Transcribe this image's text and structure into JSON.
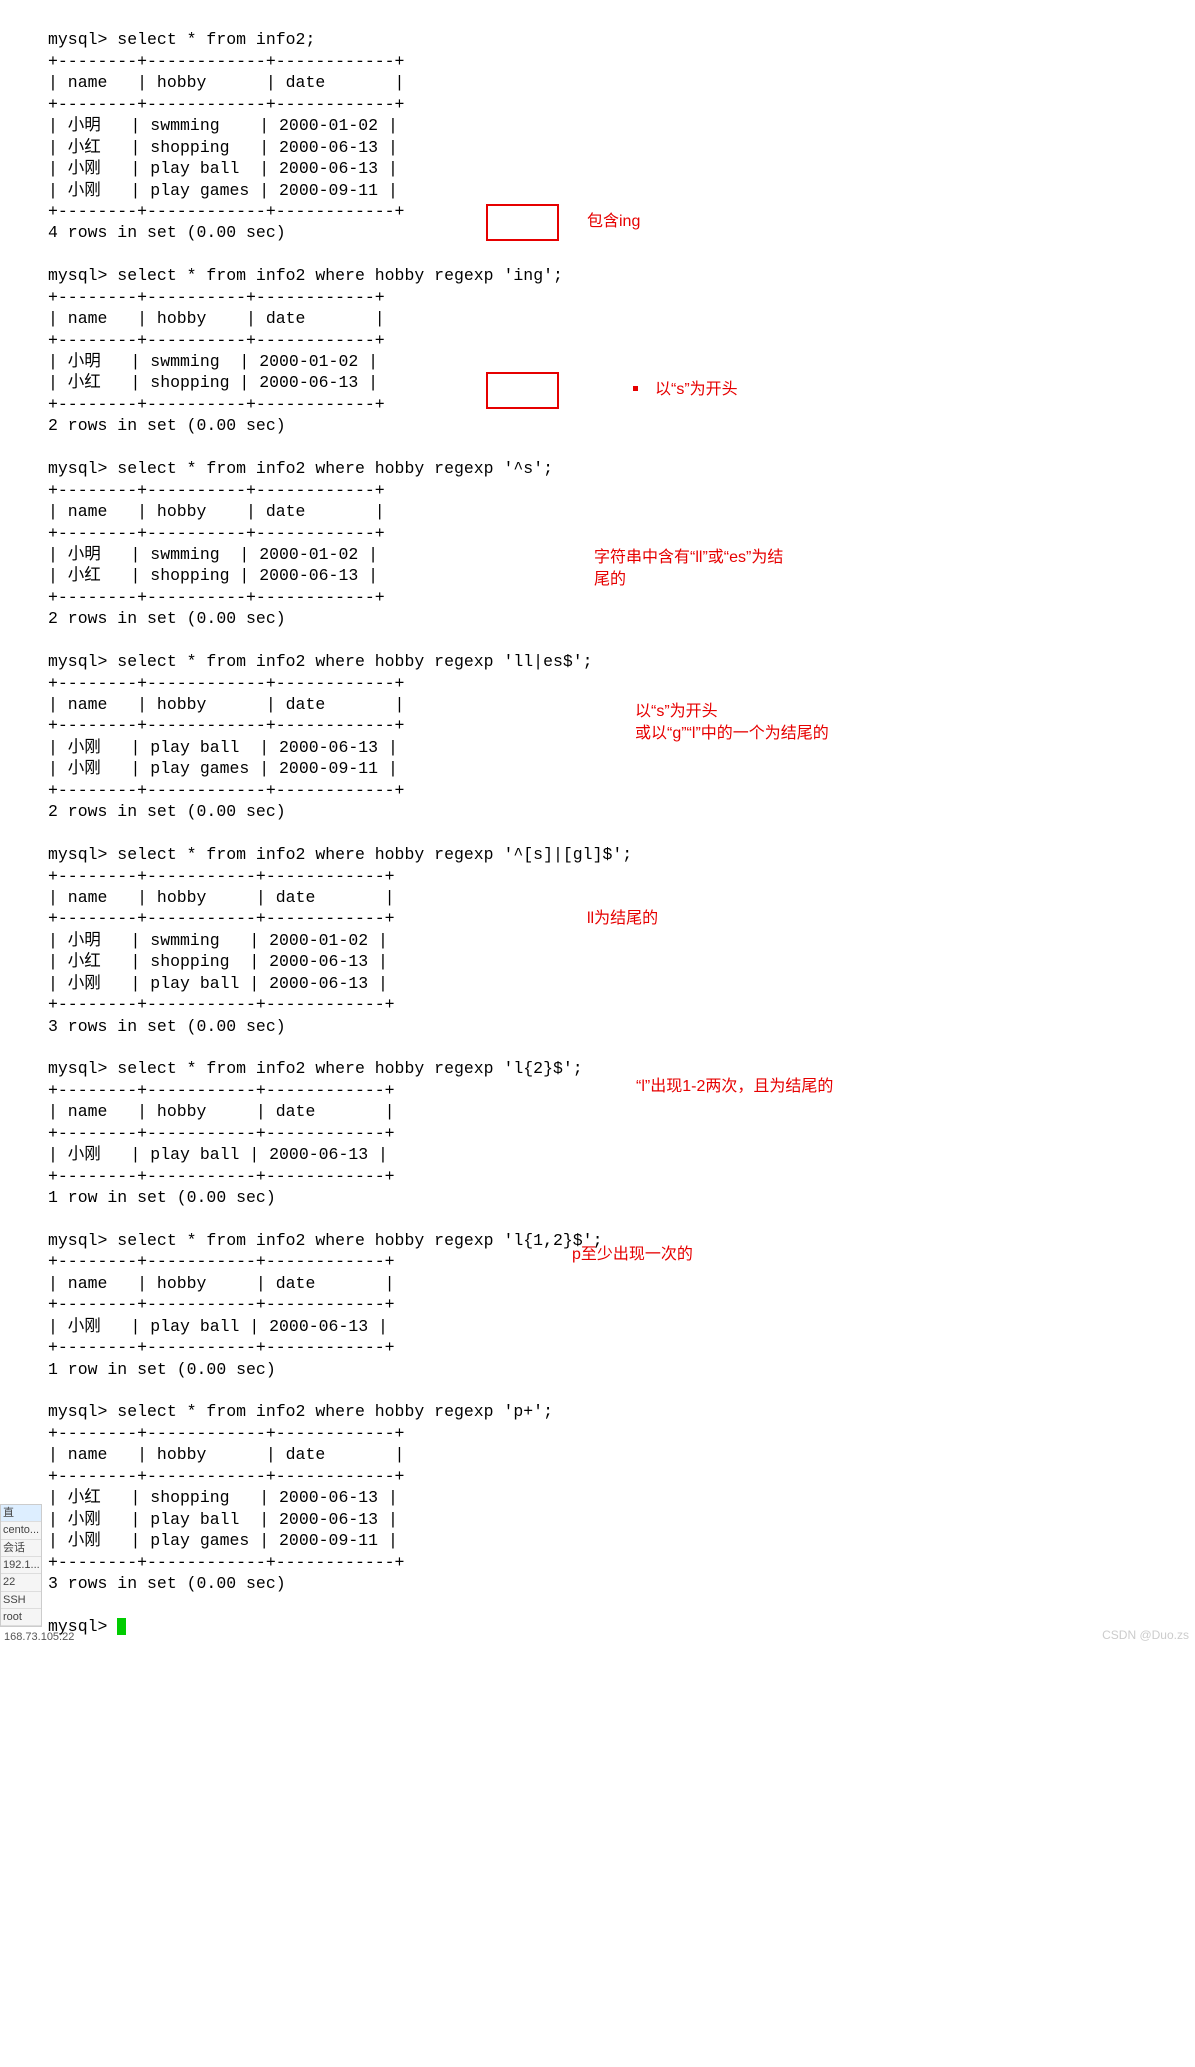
{
  "terminal": {
    "q1_prompt": "mysql> select * from info2;",
    "q1_table": "+--------+------------+------------+\n| name   | hobby      | date       |\n+--------+------------+------------+\n| 小明   | swmming    | 2000-01-02 |\n| 小红   | shopping   | 2000-06-13 |\n| 小刚   | play ball  | 2000-06-13 |\n| 小刚   | play games | 2000-09-11 |\n+--------+------------+------------+",
    "q1_result": "4 rows in set (0.00 sec)",
    "q2_prompt_a": "mysql> select * from info2 where hobby regexp ",
    "q2_prompt_b": "'ing';",
    "q2_table": "+--------+----------+------------+\n| name   | hobby    | date       |\n+--------+----------+------------+\n| 小明   | swmming  | 2000-01-02 |\n| 小红   | shopping | 2000-06-13 |\n+--------+----------+------------+",
    "q2_result": "2 rows in set (0.00 sec)",
    "q3_prompt_a": "mysql> select * from info2 where hobby regexp ",
    "q3_prompt_b": "'^s';",
    "q3_table": "+--------+----------+------------+\n| name   | hobby    | date       |\n+--------+----------+------------+\n| 小明   | swmming  | 2000-01-02 |\n| 小红   | shopping | 2000-06-13 |\n+--------+----------+------------+",
    "q3_result": "2 rows in set (0.00 sec)",
    "q4_prompt": "mysql> select * from info2 where hobby regexp 'll|es$';",
    "q4_table": "+--------+------------+------------+\n| name   | hobby      | date       |\n+--------+------------+------------+\n| 小刚   | play ball  | 2000-06-13 |\n| 小刚   | play games | 2000-09-11 |\n+--------+------------+------------+",
    "q4_result": "2 rows in set (0.00 sec)",
    "q5_prompt": "mysql> select * from info2 where hobby regexp '^[s]|[gl]$';",
    "q5_table": "+--------+-----------+------------+\n| name   | hobby     | date       |\n+--------+-----------+------------+\n| 小明   | swmming   | 2000-01-02 |\n| 小红   | shopping  | 2000-06-13 |\n| 小刚   | play ball | 2000-06-13 |\n+--------+-----------+------------+",
    "q5_result": "3 rows in set (0.00 sec)",
    "q6_prompt": "mysql> select * from info2 where hobby regexp 'l{2}$';",
    "q6_table": "+--------+-----------+------------+\n| name   | hobby     | date       |\n+--------+-----------+------------+\n| 小刚   | play ball | 2000-06-13 |\n+--------+-----------+------------+",
    "q6_result": "1 row in set (0.00 sec)",
    "q7_prompt": "mysql> select * from info2 where hobby regexp 'l{1,2}$';",
    "q7_table": "+--------+-----------+------------+\n| name   | hobby     | date       |\n+--------+-----------+------------+\n| 小刚   | play ball | 2000-06-13 |\n+--------+-----------+------------+",
    "q7_result": "1 row in set (0.00 sec)",
    "q8_prompt": "mysql> select * from info2 where hobby regexp 'p+';",
    "q8_table": "+--------+------------+------------+\n| name   | hobby      | date       |\n+--------+------------+------------+\n| 小红   | shopping   | 2000-06-13 |\n| 小刚   | play ball  | 2000-06-13 |\n| 小刚   | play games | 2000-09-11 |\n+--------+------------+------------+",
    "q8_result": "3 rows in set (0.00 sec)",
    "final_prompt": "mysql> "
  },
  "annotations": {
    "a2": "包含ing",
    "a3": "以“s”为开头",
    "a4": "字符串中含有“ll”或“es”为结尾的",
    "a5": "以“s”为开头\n或以“g”“l”中的一个为结尾的",
    "a6": "ll为结尾的",
    "a7": "“l”出现1-2两次，且为结尾的",
    "a8": "p至少出现一次的"
  },
  "sidebar": {
    "items": [
      "直",
      "cento...",
      "会话",
      "192.1...",
      "22",
      "SSH",
      "root"
    ]
  },
  "statusbar": "168.73.105:22",
  "watermark": "CSDN @Duo.zs"
}
